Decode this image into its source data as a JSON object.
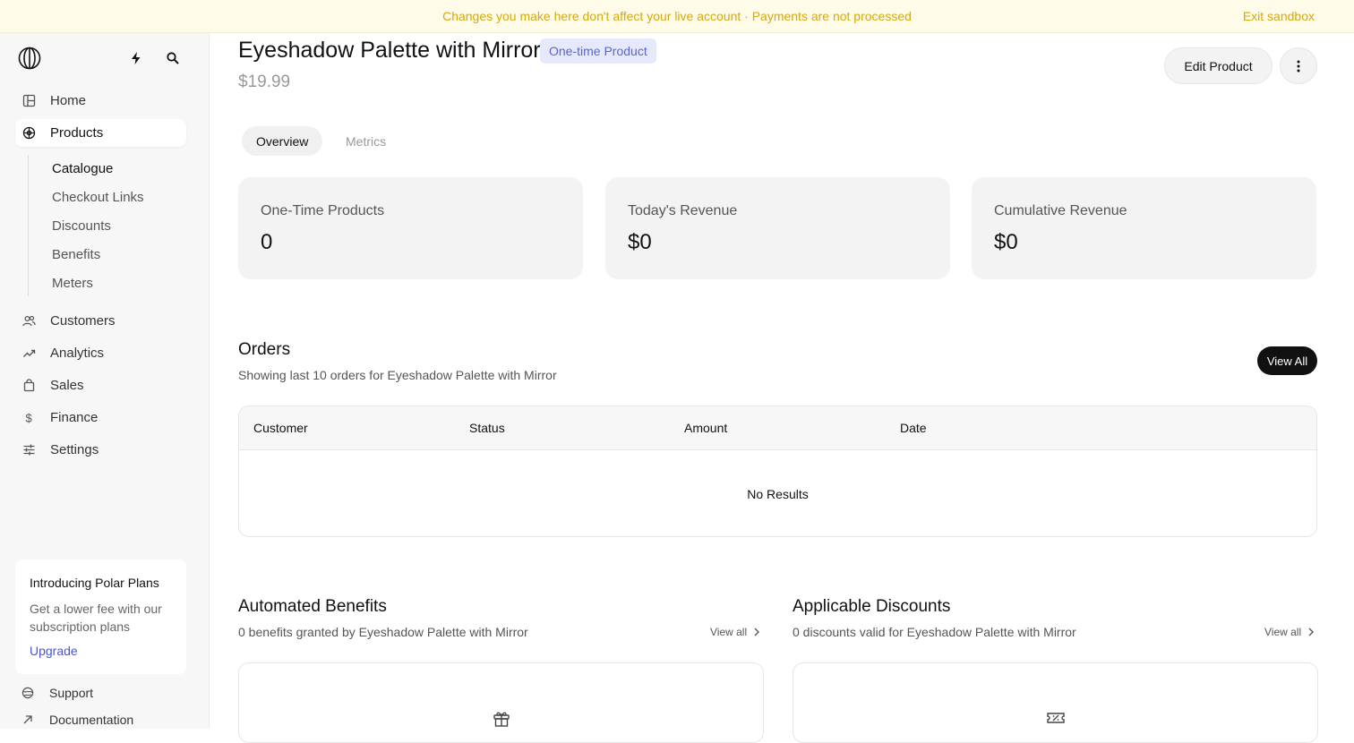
{
  "banner": {
    "message": "Changes you make here don't affect your live account · Payments are not processed",
    "exit_label": "Exit sandbox",
    "color": "#d6a90c"
  },
  "sidebar": {
    "nav": [
      {
        "label": "Home",
        "icon": "layout-icon",
        "active": false
      },
      {
        "label": "Products",
        "icon": "products-icon",
        "active": true
      },
      {
        "label": "Customers",
        "icon": "users-icon",
        "active": false
      },
      {
        "label": "Analytics",
        "icon": "trend-icon",
        "active": false
      },
      {
        "label": "Sales",
        "icon": "bag-icon",
        "active": false
      },
      {
        "label": "Finance",
        "icon": "dollar-icon",
        "active": false
      },
      {
        "label": "Settings",
        "icon": "sliders-icon",
        "active": false
      }
    ],
    "subnav": [
      {
        "label": "Catalogue",
        "active": true
      },
      {
        "label": "Checkout Links",
        "active": false
      },
      {
        "label": "Discounts",
        "active": false
      },
      {
        "label": "Benefits",
        "active": false
      },
      {
        "label": "Meters",
        "active": false
      }
    ],
    "promo": {
      "title": "Introducing Polar Plans",
      "description": "Get a lower fee with our subscription plans",
      "cta": "Upgrade"
    },
    "footer": [
      {
        "label": "Support",
        "icon": "globe-icon"
      },
      {
        "label": "Documentation",
        "icon": "arrow-up-right-icon"
      }
    ]
  },
  "product": {
    "title": "Eyeshadow Palette with Mirror",
    "badge": "One-time Product",
    "price": "$19.99",
    "edit_label": "Edit Product"
  },
  "tabs": [
    {
      "label": "Overview",
      "active": true
    },
    {
      "label": "Metrics",
      "active": false
    }
  ],
  "stats": [
    {
      "label": "One-Time Products",
      "value": "0"
    },
    {
      "label": "Today's Revenue",
      "value": "$0"
    },
    {
      "label": "Cumulative Revenue",
      "value": "$0"
    }
  ],
  "orders": {
    "title": "Orders",
    "subtitle": "Showing last 10 orders for Eyeshadow Palette with Mirror",
    "view_all": "View All",
    "columns": [
      "Customer",
      "Status",
      "Amount",
      "Date"
    ],
    "empty": "No Results"
  },
  "benefits": {
    "title": "Automated Benefits",
    "subtitle": "0 benefits granted by Eyeshadow Palette with Mirror",
    "view_all": "View all"
  },
  "discounts": {
    "title": "Applicable Discounts",
    "subtitle": "0 discounts valid for Eyeshadow Palette with Mirror",
    "view_all": "View all"
  }
}
